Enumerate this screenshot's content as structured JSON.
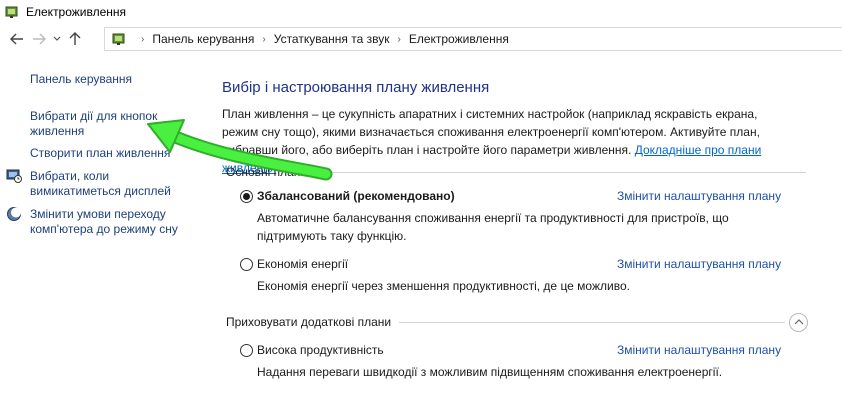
{
  "window": {
    "title": "Електроживлення",
    "app_icon": "power-options-icon"
  },
  "nav": {
    "back_icon": "back-arrow-icon",
    "forward_icon": "forward-arrow-icon",
    "recent_icon": "chevron-down-icon",
    "up_icon": "up-arrow-icon"
  },
  "address": {
    "icon": "control-panel-icon",
    "crumbs": [
      "Панель керування",
      "Устаткування та звук",
      "Електроживлення"
    ]
  },
  "sidebar": {
    "home": "Панель керування",
    "items": [
      {
        "label": "Вибрати дії для кнопок живлення"
      },
      {
        "label": "Створити план живлення"
      },
      {
        "label": "Вибрати, коли вимикатиметься дисплей",
        "icon": "display-icon"
      },
      {
        "label": "Змінити умови переходу комп'ютера до режиму сну",
        "icon": "moon-icon"
      }
    ]
  },
  "main": {
    "heading": "Вибір і настроювання плану живлення",
    "intro": "План живлення – це сукупність апаратних і системних настройок (наприклад яскравість екрана, режим сну тощо), якими визначається споживання електроенергії комп'ютером. Активуйте план, вибравши його, або виберіть план і настройте його параметри живлення.",
    "intro_link": "Докладніше про плани живлення",
    "preferred_group": "Основні плани",
    "hidden_group": "Приховувати додаткові плани",
    "change_link": "Змінити налаштування плану",
    "plans": [
      {
        "name": "Збалансований (рекомендовано)",
        "desc": "Автоматичне балансування споживання енергії та продуктивності для пристроїв, що підтримують таку функцію.",
        "selected": true
      },
      {
        "name": "Економія енергії",
        "desc": "Економія енергії через зменшення продуктивності, де це можливо.",
        "selected": false
      },
      {
        "name": "Висока продуктивність",
        "desc": "Надання переваги швидкодії з можливим підвищенням споживання електроенергії.",
        "selected": false
      }
    ]
  },
  "colors": {
    "link": "#1f3f7a",
    "heading": "#1e3287",
    "accent_arrow": "#3fe036"
  }
}
